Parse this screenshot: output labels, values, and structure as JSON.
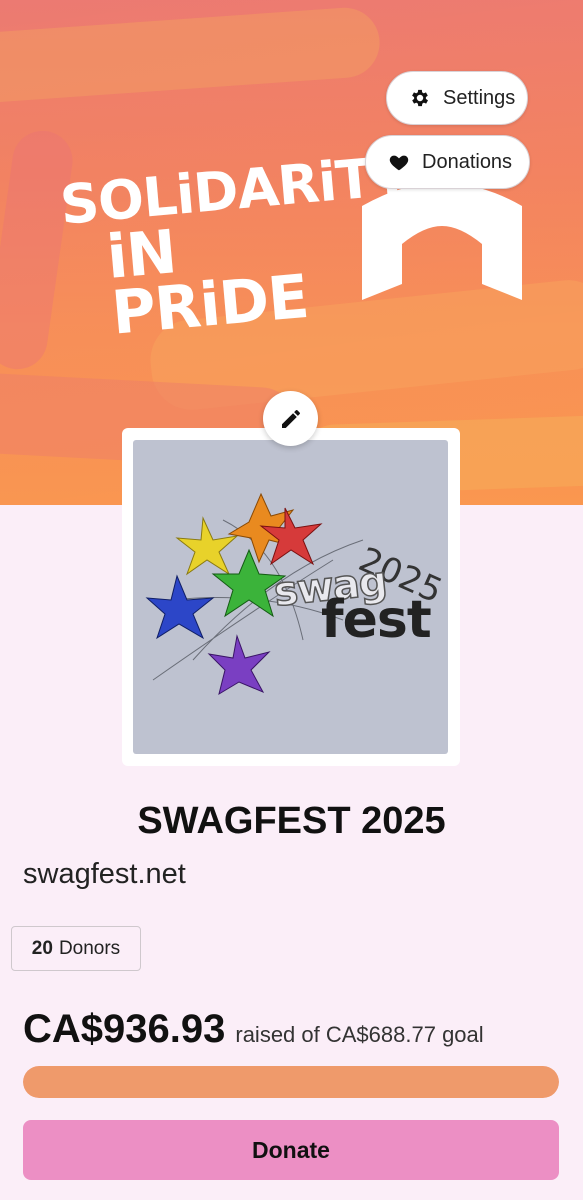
{
  "banner": {
    "logo_line1": "SOLiDARiTY",
    "logo_line2": "iN PRiDE"
  },
  "top_actions": {
    "settings_label": "Settings",
    "settings_icon": "gear-icon",
    "donations_label": "Donations",
    "donations_icon": "heart-icon"
  },
  "edit": {
    "icon": "pencil-icon"
  },
  "event_image": {
    "word_swag": "swag",
    "word_fest": "fest",
    "year": "2025"
  },
  "campaign": {
    "title": "SWAGFEST 2025",
    "website": "swagfest.net",
    "donor_count": "20",
    "donor_label": "Donors",
    "raised_amount": "CA$936.93",
    "raised_suffix": "raised of CA$688.77 goal",
    "progress_percent": 100,
    "donate_label": "Donate"
  },
  "colors": {
    "progress_fill": "#ef9a6b",
    "donate_button": "#ec8fc4",
    "page_background": "#fbeef8"
  }
}
